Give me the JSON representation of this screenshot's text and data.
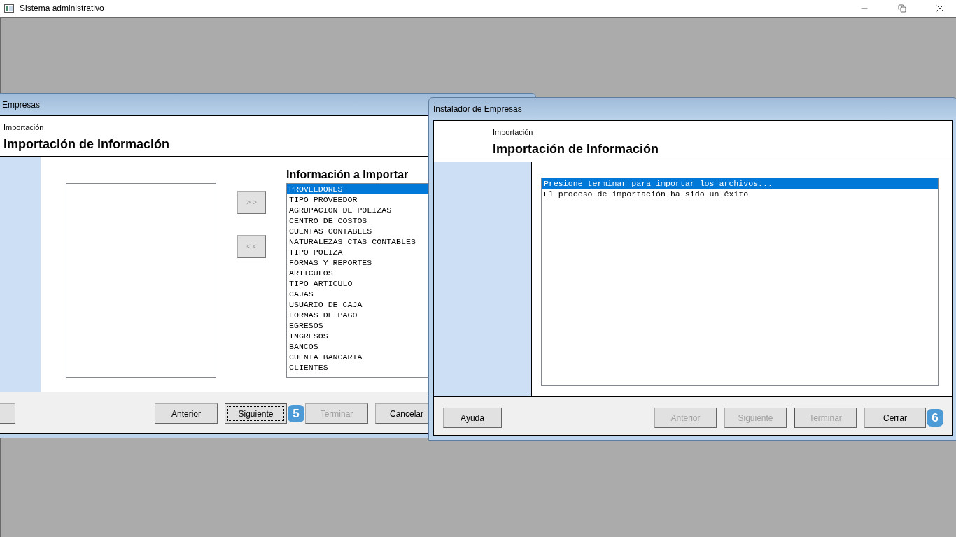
{
  "app": {
    "title": "Sistema administrativo"
  },
  "back_dialog": {
    "title": "Empresas",
    "header": {
      "section": "Importación",
      "heading": "Importación de Información"
    },
    "move_buttons": [
      "> >",
      "< <"
    ],
    "list_heading": "Información a Importar",
    "items": [
      {
        "label": "PROVEEDORES",
        "selected": true
      },
      {
        "label": "TIPO PROVEEDOR",
        "selected": false
      },
      {
        "label": "AGRUPACION DE POLIZAS",
        "selected": false
      },
      {
        "label": "CENTRO DE COSTOS",
        "selected": false
      },
      {
        "label": "CUENTAS CONTABLES",
        "selected": false
      },
      {
        "label": "NATURALEZAS CTAS CONTABLES",
        "selected": false
      },
      {
        "label": "TIPO POLIZA",
        "selected": false
      },
      {
        "label": "FORMAS Y REPORTES",
        "selected": false
      },
      {
        "label": "ARTICULOS",
        "selected": false
      },
      {
        "label": "TIPO ARTICULO",
        "selected": false
      },
      {
        "label": "CAJAS",
        "selected": false
      },
      {
        "label": "USUARIO DE CAJA",
        "selected": false
      },
      {
        "label": "FORMAS DE PAGO",
        "selected": false
      },
      {
        "label": "EGRESOS",
        "selected": false
      },
      {
        "label": "INGRESOS",
        "selected": false
      },
      {
        "label": "BANCOS",
        "selected": false
      },
      {
        "label": "CUENTA BANCARIA",
        "selected": false
      },
      {
        "label": "CLIENTES",
        "selected": false
      }
    ],
    "buttons": [
      {
        "label": "Anterior",
        "disabled": false,
        "focused": false
      },
      {
        "label": "Siguiente",
        "disabled": false,
        "focused": true,
        "callout": "5"
      },
      {
        "label": "Terminar",
        "disabled": true,
        "focused": false
      },
      {
        "label": "Cancelar",
        "disabled": false,
        "focused": false
      }
    ]
  },
  "front_dialog": {
    "title": "Instalador de Empresas",
    "header": {
      "section": "Importación",
      "heading": "Importación de Información"
    },
    "log": [
      {
        "text": "Presione terminar para importar los archivos...",
        "selected": true
      },
      {
        "text": "El proceso de importación ha sido un éxito",
        "selected": false
      }
    ],
    "help_button": {
      "label": "Ayuda",
      "disabled": false
    },
    "buttons": [
      {
        "label": "Anterior",
        "disabled": true,
        "focused": false
      },
      {
        "label": "Siguiente",
        "disabled": true,
        "focused": false
      },
      {
        "label": "Terminar",
        "disabled": true,
        "focused": true
      },
      {
        "label": "Cerrar",
        "disabled": false,
        "focused": false,
        "callout": "6"
      }
    ]
  }
}
